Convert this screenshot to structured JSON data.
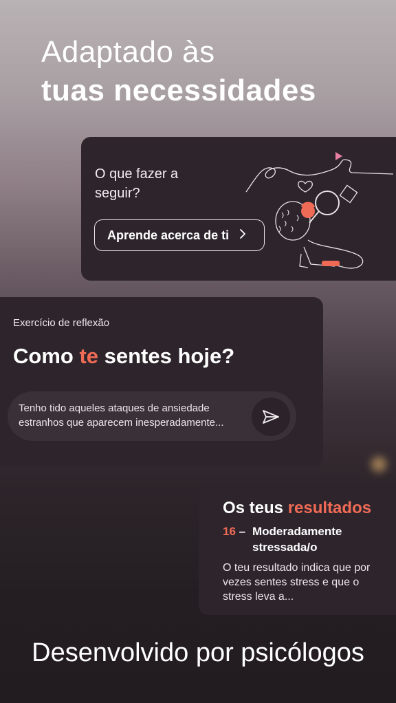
{
  "hero": {
    "line1": "Adaptado às",
    "line2": "tuas necessidades"
  },
  "next_card": {
    "question": "O que fazer a seguir?",
    "button_label": "Aprende acerca de ti",
    "button_icon": "chevron-right-icon"
  },
  "reflection_card": {
    "subtitle": "Exercício de reflexão",
    "title_before": "Como ",
    "title_accent": "te",
    "title_after": " sentes hoje?",
    "entry_text": "Tenho tido aqueles ataques de ansiedade estranhos que aparecem inesperadamente...",
    "send_icon": "send-icon"
  },
  "results_card": {
    "title_before": "Os teus ",
    "title_accent": "resultados",
    "score": "16",
    "dash": "–",
    "score_label": "Moderadamente stressada/o",
    "description": "O teu resultado indica que por vezes sentes stress e que o stress leva a..."
  },
  "footer": {
    "text": "Desenvolvido por psicólogos"
  },
  "colors": {
    "accent": "#f06b55",
    "card": "#2e252c"
  }
}
